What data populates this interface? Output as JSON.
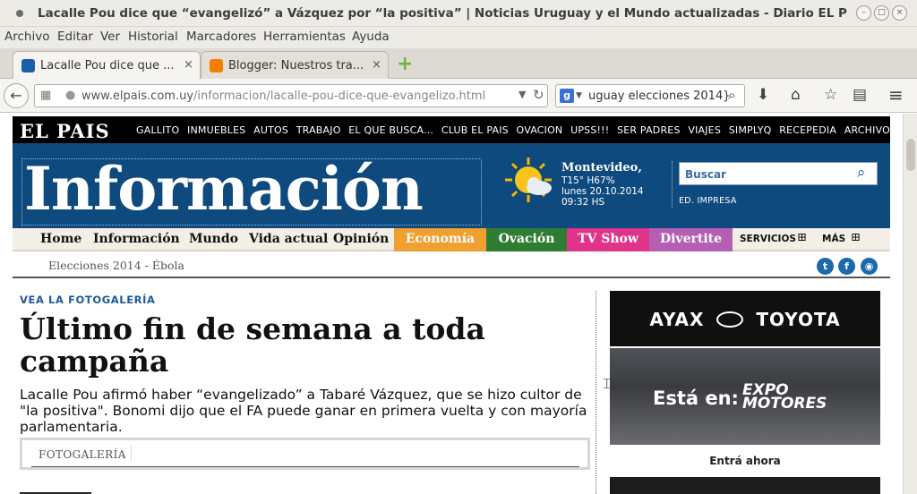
{
  "window": {
    "title": "Lacalle Pou dice que “evangelizó” a Vázquez por “la positiva” | Noticias Uruguay y el Mundo actualizadas - Diario EL P"
  },
  "menubar": [
    "Archivo",
    "Editar",
    "Ver",
    "Historial",
    "Marcadores",
    "Herramientas",
    "Ayuda"
  ],
  "tabs": [
    {
      "label": "Lacalle Pou dice que ...",
      "close": "×"
    },
    {
      "label": "Blogger: Nuestros tra...",
      "close": "×"
    }
  ],
  "newtab": "+",
  "urlbar": {
    "host": "www.elpais.com.uy",
    "path": "/informacion/lacalle-pou-dice-que-evangelizo.html",
    "search_text": "uguay elecciones 2014}"
  },
  "site": {
    "logo": "EL PAIS",
    "toplinks": [
      "GALLITO",
      "INMUEBLES",
      "AUTOS",
      "TRABAJO",
      "EL QUE BUSCA...",
      "CLUB EL PAIS",
      "OVACION",
      "UPSS!!!",
      "SER PADRES",
      "VIAJES",
      "SIMPLYQ",
      "RECEPEDIA",
      "ARCHIVO FOTOS"
    ],
    "section_title": "Información",
    "weather": {
      "city": "Montevideo,",
      "temp": "T15° H67%",
      "date": "lunes 20.10.2014",
      "time": "09:32 HS"
    },
    "search_placeholder": "Buscar",
    "ed_impresa": "ED. IMPRESA",
    "nav": [
      "Home",
      "Información",
      "Mundo",
      "Vida actual",
      "Opinión"
    ],
    "sections": [
      {
        "label": "Economía",
        "color": "#f0a030"
      },
      {
        "label": "Ovación",
        "color": "#2e7d32"
      },
      {
        "label": "TV Show",
        "color": "#e0338a"
      },
      {
        "label": "Divertite",
        "color": "#b45fb4"
      }
    ],
    "servicios": "SERVICIOS",
    "mas": "MÁS",
    "breadcrumb": "Elecciones 2014 - Ébola"
  },
  "article": {
    "kicker": "VEA LA FOTOGALERÍA",
    "headline": "Último fin de semana a toda campaña",
    "lead": "Lacalle Pou afirmó haber “evangelizado” a Tabaré Vázquez, que se hizo cultor de \"la positiva\".  Bonomi dijo que el FA puede ganar en primera vuelta y con mayoría parlamentaria.",
    "fotogaleria": "FOTOGALERÍA"
  },
  "ad": {
    "brand_left": "AYAX",
    "brand_right": "TOYOTA",
    "esta_en": "Está en:",
    "expo": "EXPO",
    "motores": "MOTORES",
    "cta": "Entrá ahora"
  }
}
